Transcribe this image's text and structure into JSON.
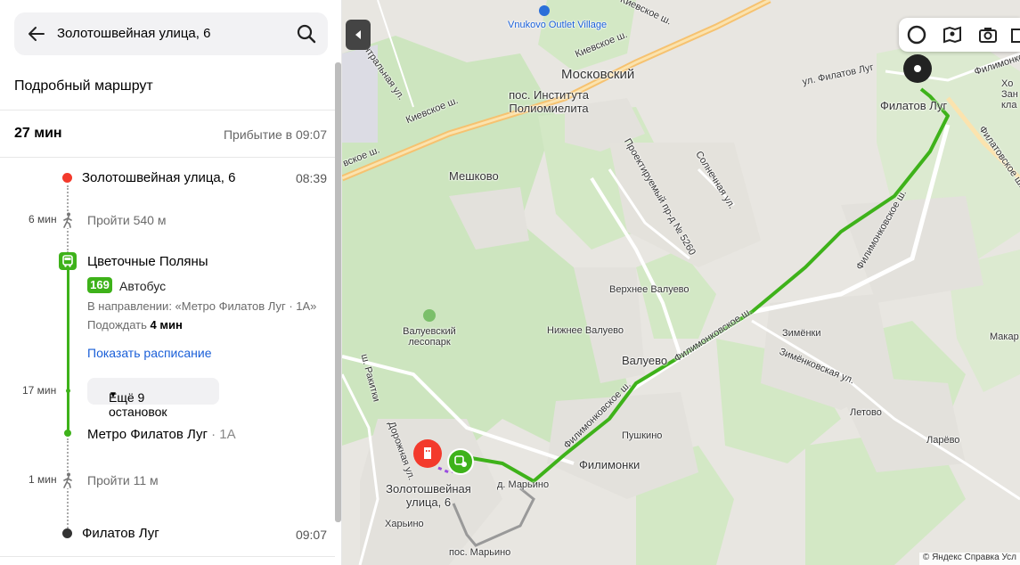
{
  "search": {
    "value": "Золотошвейная улица, 6"
  },
  "panel": {
    "title": "Подробный маршрут",
    "duration": "27 мин",
    "arrival": "Прибытие в 09:07"
  },
  "timeline": {
    "start": {
      "name": "Золотошвейная улица, 6",
      "time": "08:39"
    },
    "walk1": {
      "duration": "6 мин",
      "text": "Пройти 540 м"
    },
    "board": {
      "stop": "Цветочные Поляны",
      "route_number": "169",
      "route_type": "Автобус",
      "direction": "В направлении: «Метро Филатов Луг · 1А»",
      "wait_prefix": "Подождать",
      "wait_value": "4 мин",
      "schedule_link": "Показать расписание"
    },
    "ride": {
      "duration": "17 мин",
      "more_stops": "Ещё 9 остановок"
    },
    "alight": {
      "stop": "Метро Филатов Луг",
      "platform": "· 1А"
    },
    "walk2": {
      "duration": "1 мин",
      "text": "Пройти 11 м"
    },
    "end": {
      "name": "Филатов Луг",
      "time": "09:07"
    }
  },
  "map": {
    "labels": {
      "vnukovo": "Vnukovo Outlet Village",
      "moskovsky": "Московский",
      "polio": "пос. Института Полиомиелита",
      "meshkovo": "Мешково",
      "kievskoe1": "Киевское ш.",
      "kievskoe2": "Киевское ш.",
      "kievskoe3": "вское ш.",
      "kievskoe_top": "Киевское ш.",
      "tsentralnaya": "Центральная ул.",
      "solnechnaya": "Солнечная ул.",
      "proj_road": "Проектируемый пр-д № 5260",
      "filimonkovskoe1": "Филимонковское ш.",
      "filimonkovskoe2": "Филимонковское ш.",
      "filimonkovskoe3": "Филимонковское ш.",
      "verkhnee": "Верхнее Валуево",
      "nizhnee": "Нижнее Валуево",
      "valuevo": "Валуево",
      "valuevsky_park": "Валуевский лесопарк",
      "zimenki": "Зимёнки",
      "zimenkovskaya": "Зимёнковская ул.",
      "letovo": "Летово",
      "larevo": "Ларёво",
      "makar": "Макар",
      "pushkino": "Пушкино",
      "filimonki": "Филимонки",
      "d_maryino": "д. Марьино",
      "pos_maryino": "пос. Марьино",
      "kharyno": "Харьино",
      "raduki": "ш. Ракитки",
      "dorozhnaya": "Дорожная ул.",
      "filatov_lug": "Филатов Луг",
      "filatovskoe": "Филатовское ш.",
      "ul_filatov": "ул. Филатов Луг",
      "filimonk_top": "Филимонковское",
      "zolotosh": "Золотошвейная улица, 6",
      "kho": "Хо",
      "zan": "Зан",
      "kla": "кла"
    },
    "footer": "© Яндекс   Справка   Усл"
  }
}
